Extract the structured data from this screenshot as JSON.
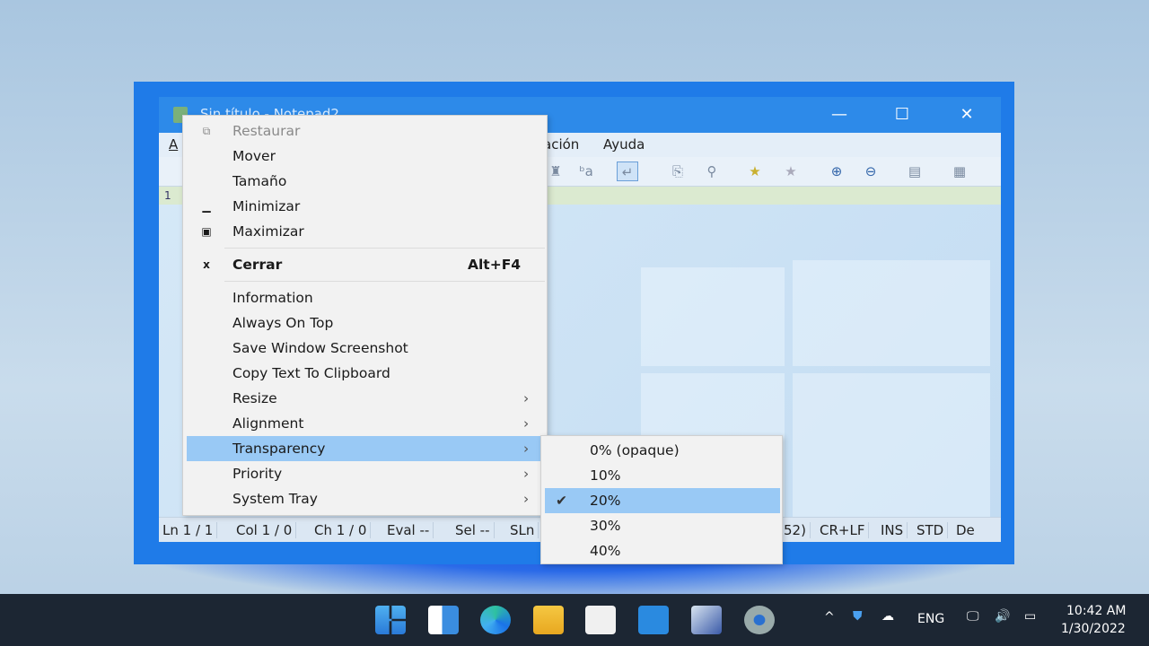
{
  "window": {
    "title": "Sin título - Notepad2",
    "controls": {
      "minimize": "—",
      "maximize": "☐",
      "close": "✕"
    }
  },
  "menubar": {
    "items": [
      "A",
      "ación",
      "Ayuda"
    ]
  },
  "editor": {
    "line_number": "1"
  },
  "status": [
    "Ln 1 / 1",
    "Col 1 / 0",
    "Ch 1 / 0",
    "Eval --",
    "Sel --",
    "SLn",
    "52)",
    "CR+LF",
    "INS",
    "STD",
    "De"
  ],
  "context_menu": {
    "items": [
      {
        "label": "Restaurar",
        "icon": "restore-icon",
        "glyph": "⧉",
        "disabled": true
      },
      {
        "label": "Mover"
      },
      {
        "label": "Tamaño"
      },
      {
        "label": "Minimizar",
        "icon": "minimize-icon",
        "glyph": "▁"
      },
      {
        "label": "Maximizar",
        "icon": "maximize-icon",
        "glyph": "▣"
      },
      {
        "label": "Cerrar",
        "icon": "close-icon",
        "glyph": "x",
        "accel": "Alt+F4",
        "bold": true
      },
      {
        "label": "Information"
      },
      {
        "label": "Always On Top"
      },
      {
        "label": "Save Window Screenshot"
      },
      {
        "label": "Copy Text To Clipboard"
      },
      {
        "label": "Resize",
        "submenu": true
      },
      {
        "label": "Alignment",
        "submenu": true
      },
      {
        "label": "Transparency",
        "submenu": true,
        "selected": true
      },
      {
        "label": "Priority",
        "submenu": true
      },
      {
        "label": "System Tray",
        "submenu": true
      }
    ]
  },
  "transparency_submenu": {
    "items": [
      "0% (opaque)",
      "10%",
      "20%",
      "30%",
      "40%"
    ],
    "checked": "20%"
  },
  "taskbar": {
    "language": "ENG",
    "time": "10:42 AM",
    "date": "1/30/2022"
  },
  "colors": {
    "accent": "#1f7be8",
    "selection": "#99c9f5",
    "taskbar": "#1c2633"
  }
}
